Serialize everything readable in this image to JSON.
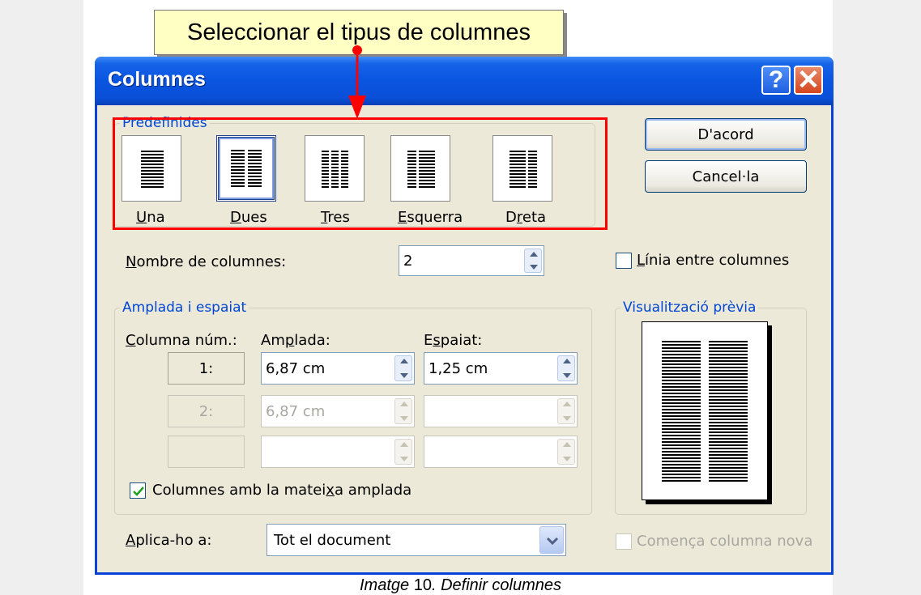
{
  "callout": {
    "text": "Seleccionar el tipus de columnes"
  },
  "dialog": {
    "title": "Columnes",
    "help_label": "?",
    "close_label": "✕",
    "presets": {
      "legend": "Predefinides",
      "items": [
        {
          "label": "Una",
          "accesskey": "U",
          "rest": "na"
        },
        {
          "label": "Dues",
          "accesskey": "D",
          "rest": "ues",
          "selected": true
        },
        {
          "label": "Tres",
          "accesskey": "T",
          "rest": "res"
        },
        {
          "label": "Esquerra",
          "accesskey": "E",
          "rest": "squerra"
        },
        {
          "label": "Dreta",
          "pre": "D",
          "accesskey": "r",
          "rest": "eta"
        }
      ]
    },
    "ok_label": "D'acord",
    "cancel_label": "Cancel·la",
    "num_columns": {
      "label_key": "N",
      "label_rest": "ombre de columnes:",
      "value": "2"
    },
    "line_between": {
      "label_key": "L",
      "label_rest": "ínia entre columnes",
      "checked": false
    },
    "width_spacing": {
      "legend": "Amplada i espaiat",
      "col_header_key": "C",
      "col_header_rest": "olumna núm.:",
      "width_header_pre": "Am",
      "width_header_key": "p",
      "width_header_rest": "lada:",
      "spacing_header_pre": "E",
      "spacing_header_key": "s",
      "spacing_header_rest": "paiat:",
      "rows": [
        {
          "num": "1:",
          "width": "6,87 cm",
          "spacing": "1,25 cm",
          "enabled": true
        },
        {
          "num": "2:",
          "width": "6,87 cm",
          "spacing": "",
          "enabled": false
        },
        {
          "num": "",
          "width": "",
          "spacing": "",
          "enabled": false
        }
      ],
      "equal_width": {
        "pre": "Columnes amb la matei",
        "key": "x",
        "rest": "a amplada",
        "checked": true
      }
    },
    "preview": {
      "legend": "Visualització prèvia"
    },
    "apply_to": {
      "label_key": "A",
      "label_rest": "plica-ho a:",
      "value": "Tot el document"
    },
    "start_new_column": {
      "label": "Comença columna nova",
      "checked": false,
      "enabled": false
    }
  },
  "caption": {
    "prefix": "Imatge",
    "number": "10",
    "text": ". Definir columnes"
  },
  "colors": {
    "title_bar": "#0a55e0",
    "highlight": "#ff0000",
    "callout": "#ffffc4"
  }
}
